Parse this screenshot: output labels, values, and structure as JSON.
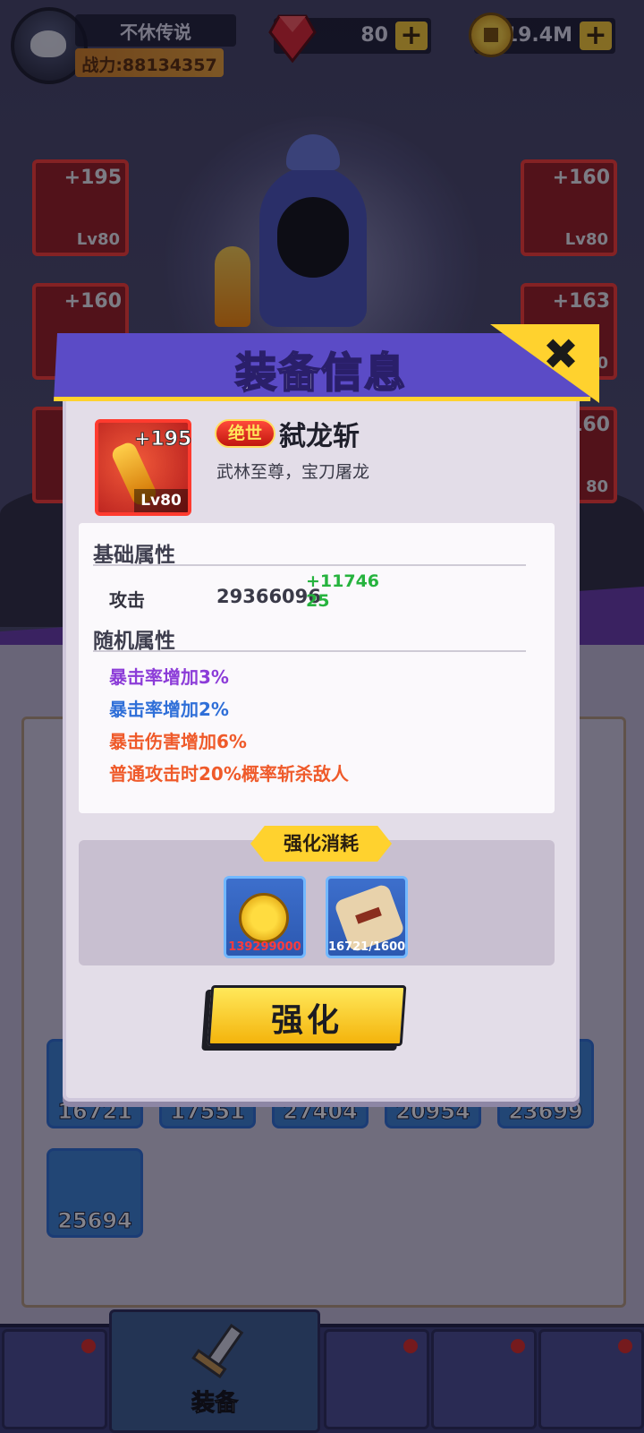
{
  "player": {
    "name": "不休传说",
    "power": "战力:88134357"
  },
  "resources": {
    "gems": "80",
    "gold": "19.4M",
    "plus": "+"
  },
  "side_slots": {
    "left": [
      {
        "plus": "+195",
        "level": "Lv80"
      },
      {
        "plus": "+160",
        "level": ""
      }
    ],
    "right": [
      {
        "plus": "+160",
        "level": "Lv80"
      },
      {
        "plus": "+163",
        "level": "80"
      },
      {
        "plus": "160",
        "level": "80"
      }
    ]
  },
  "inventory": [
    "16721",
    "17551",
    "27404",
    "20954",
    "23699",
    "25694"
  ],
  "nav": {
    "active_label": "装备"
  },
  "modal": {
    "title": "装备信息",
    "close_symbol": "✖",
    "item": {
      "plus": "+195",
      "level": "Lv80",
      "rarity": "绝世",
      "name": "弑龙斩",
      "description": "武林至尊，宝刀屠龙"
    },
    "base_section": "基础属性",
    "base_attr": {
      "label": "攻击",
      "value": "29366096",
      "bonus": "+1174625"
    },
    "random_section": "随机属性",
    "random_attrs": [
      {
        "text": "暴击率增加3%",
        "color": "#8c3cd8"
      },
      {
        "text": "暴击率增加2%",
        "color": "#2f6fd8"
      },
      {
        "text": "暴击伤害增加6%",
        "color": "#ef5a2a"
      },
      {
        "text": "普通攻击时20%概率斩杀敌人",
        "color": "#ef5a2a"
      }
    ],
    "cost_title": "强化消耗",
    "costs": [
      {
        "amount": "139299000",
        "color": "#ff3b3b",
        "icon": "gold-coins-icon"
      },
      {
        "amount": "16721/1600",
        "color": "#ffffff",
        "icon": "scroll-icon"
      }
    ],
    "enhance_label": "强化"
  }
}
